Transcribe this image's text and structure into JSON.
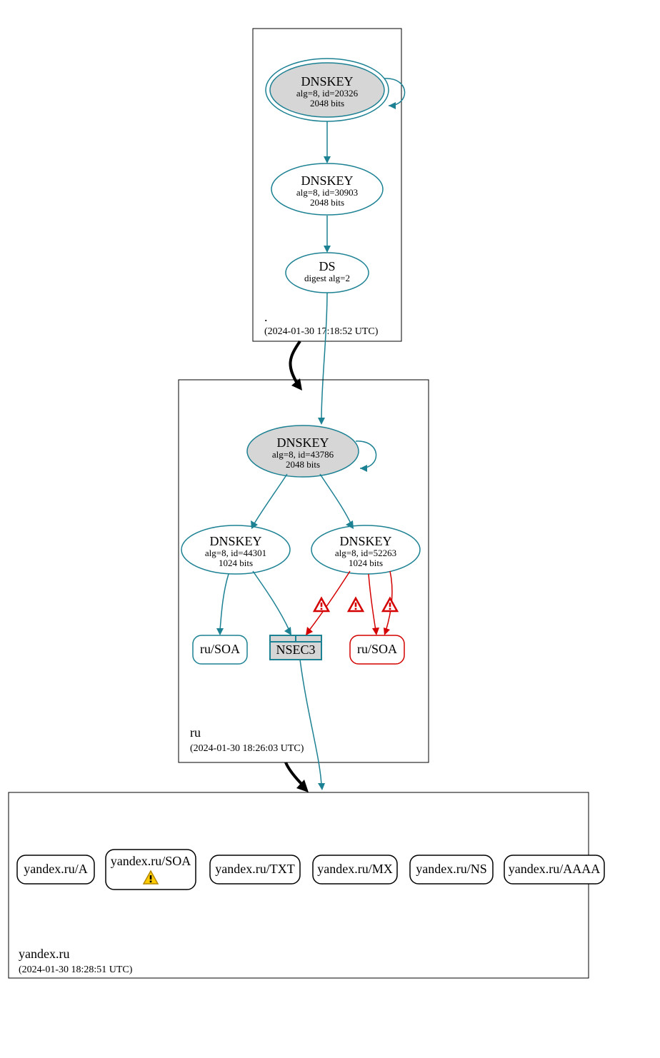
{
  "colors": {
    "teal": "#1c8193",
    "red": "#d40000",
    "grey": "#d6d6d6"
  },
  "zones": {
    "root": {
      "label": ".",
      "timestamp": "(2024-01-30 17:18:52 UTC)"
    },
    "ru": {
      "label": "ru",
      "timestamp": "(2024-01-30 18:26:03 UTC)"
    },
    "yandex": {
      "label": "yandex.ru",
      "timestamp": "(2024-01-30 18:28:51 UTC)"
    }
  },
  "nodes": {
    "root_ksk": {
      "title": "DNSKEY",
      "line1": "alg=8, id=20326",
      "line2": "2048 bits"
    },
    "root_zsk": {
      "title": "DNSKEY",
      "line1": "alg=8, id=30903",
      "line2": "2048 bits"
    },
    "root_ds": {
      "title": "DS",
      "line1": "digest alg=2"
    },
    "ru_ksk": {
      "title": "DNSKEY",
      "line1": "alg=8, id=43786",
      "line2": "2048 bits"
    },
    "ru_zsk1": {
      "title": "DNSKEY",
      "line1": "alg=8, id=44301",
      "line2": "1024 bits"
    },
    "ru_zsk2": {
      "title": "DNSKEY",
      "line1": "alg=8, id=52263",
      "line2": "1024 bits"
    },
    "ru_soa_ok": {
      "label": "ru/SOA"
    },
    "ru_soa_bad": {
      "label": "ru/SOA"
    },
    "nsec3": {
      "label": "NSEC3"
    },
    "y_a": {
      "label": "yandex.ru/A"
    },
    "y_soa": {
      "label": "yandex.ru/SOA"
    },
    "y_txt": {
      "label": "yandex.ru/TXT"
    },
    "y_mx": {
      "label": "yandex.ru/MX"
    },
    "y_ns": {
      "label": "yandex.ru/NS"
    },
    "y_aaaa": {
      "label": "yandex.ru/AAAA"
    }
  }
}
